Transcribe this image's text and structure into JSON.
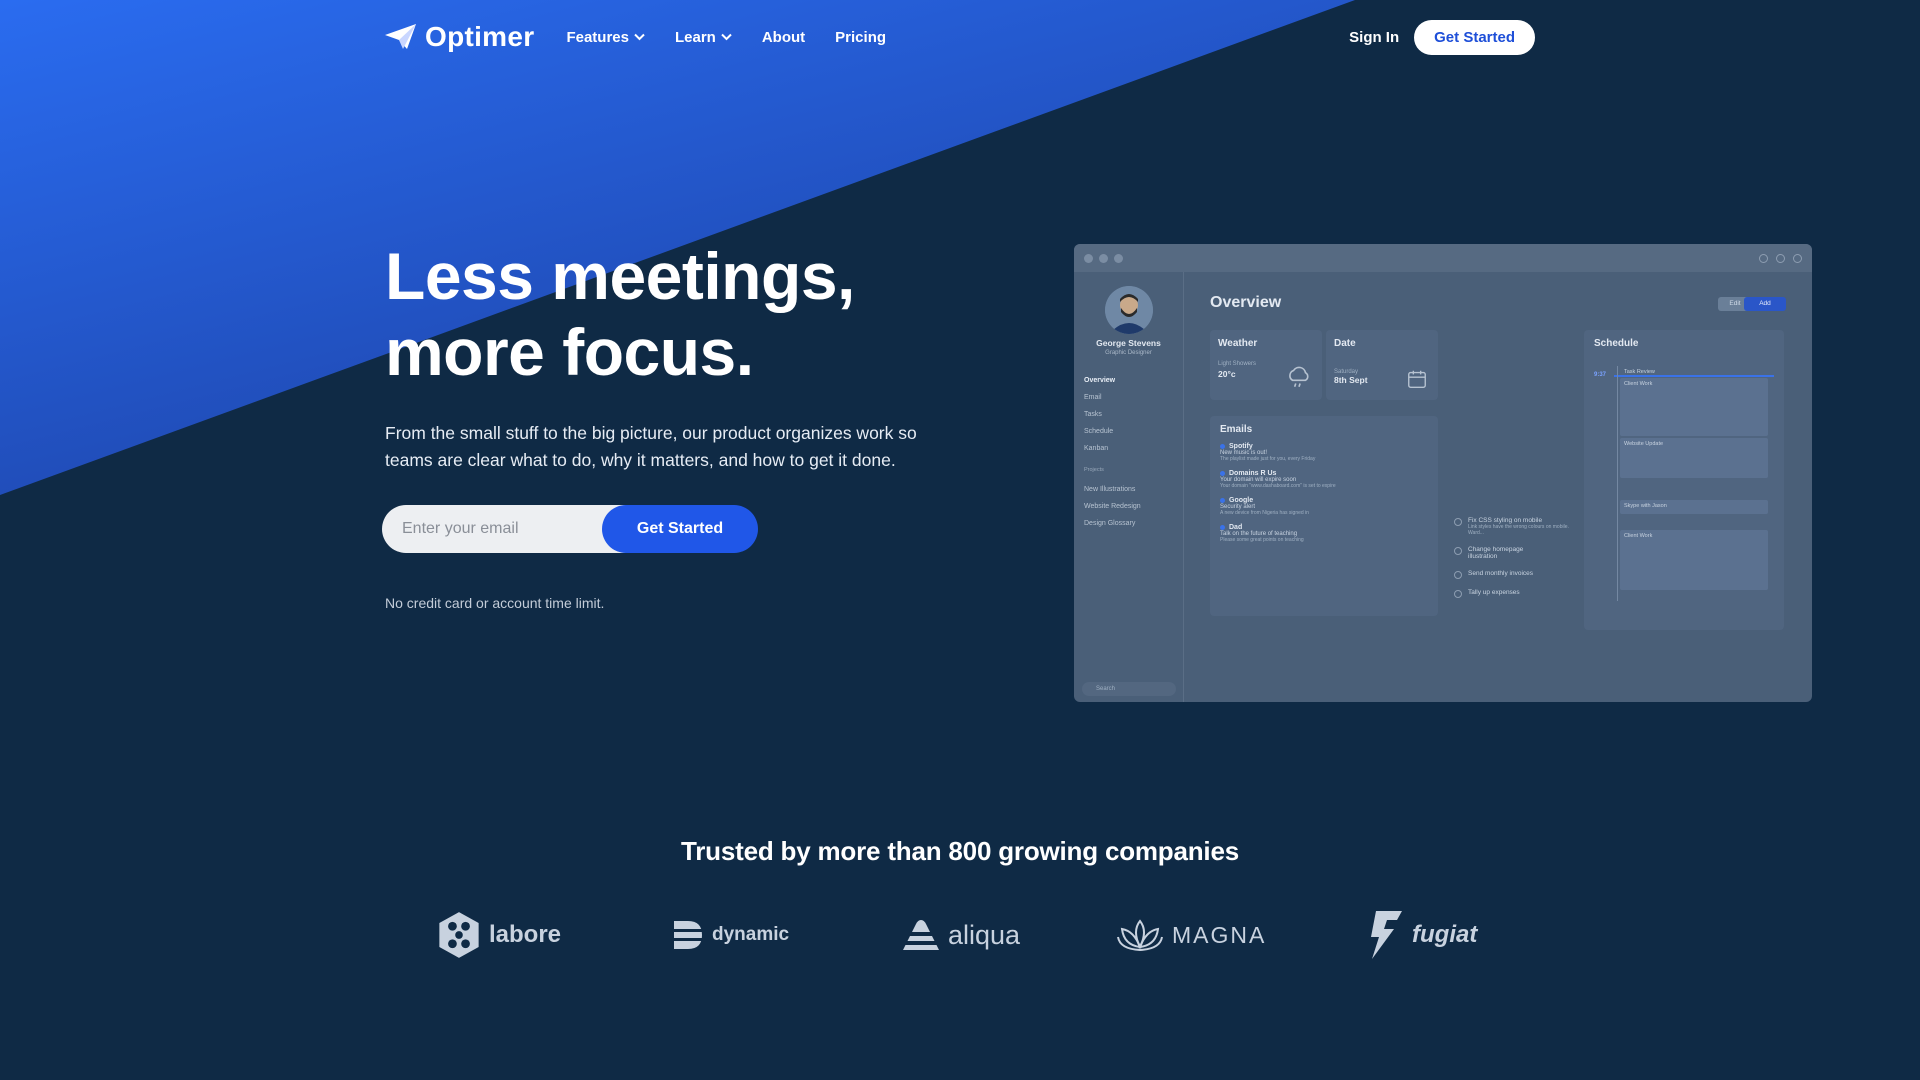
{
  "nav": {
    "brand": "Optimer",
    "menu": [
      {
        "label": "Features",
        "has_dropdown": true
      },
      {
        "label": "Learn",
        "has_dropdown": true
      },
      {
        "label": "About",
        "has_dropdown": false
      },
      {
        "label": "Pricing",
        "has_dropdown": false
      }
    ],
    "sign_in": "Sign In",
    "cta": "Get Started"
  },
  "hero": {
    "headline_line1": "Less meetings,",
    "headline_line2": "more focus.",
    "subtext": "From the small stuff to the big picture, our product organizes work so teams are clear what to do, why it matters, and how to get it done.",
    "email_placeholder": "Enter your email",
    "cta": "Get Started",
    "note": "No credit card or account time limit."
  },
  "mockup": {
    "user_name": "George Stevens",
    "user_role": "Graphic Designer",
    "sidebar": [
      "Overview",
      "Email",
      "Tasks",
      "Schedule",
      "Kanban"
    ],
    "projects_label": "Projects",
    "projects": [
      "New Illustrations",
      "Website Redesign",
      "Design Glossary"
    ],
    "search": "Search",
    "title": "Overview",
    "edit": "Edit",
    "add": "Add",
    "weather": {
      "title": "Weather",
      "desc": "Light Showers",
      "temp": "20°c"
    },
    "date": {
      "title": "Date",
      "day": "Saturday",
      "value": "8th Sept"
    },
    "emails_title": "Emails",
    "emails": [
      {
        "from": "Spotify",
        "subject": "New music is out!",
        "preview": "The playlist made just for you, every Friday"
      },
      {
        "from": "Domains R Us",
        "subject": "Your domain will expire soon",
        "preview": "Your domain \"www.dashaboard.com\" is set to expire"
      },
      {
        "from": "Google",
        "subject": "Security alert",
        "preview": "A new device from Nigeria has signed in"
      },
      {
        "from": "Dad",
        "subject": "Talk on the future of teaching",
        "preview": "Please some great points on teaching"
      }
    ],
    "tasks": [
      {
        "title": "Fix CSS styling on mobile",
        "desc": "Link styles have the wrong colours on mobile. Ward..."
      },
      {
        "title": "Change homepage illustration",
        "desc": ""
      },
      {
        "title": "Send monthly invoices",
        "desc": ""
      },
      {
        "title": "Tally up expenses",
        "desc": ""
      }
    ],
    "schedule_title": "Schedule",
    "schedule_time": "9:37",
    "schedule_items": [
      "Task Review",
      "Client Work",
      "Website Update",
      "Skype with Jason",
      "Client Work"
    ]
  },
  "trusted": {
    "heading": "Trusted by more than 800 growing companies",
    "logos": [
      {
        "name": "labore",
        "icon": "hexagon-molecule-icon"
      },
      {
        "name": "dynamic",
        "icon": "stacked-d-icon"
      },
      {
        "name": "aliqua",
        "icon": "triangle-stripes-icon"
      },
      {
        "name": "MAGNA",
        "icon": "lotus-icon"
      },
      {
        "name": "fugiat",
        "icon": "lightning-f-icon"
      }
    ]
  },
  "colors": {
    "background": "#0f2a45",
    "accent": "#2057e8",
    "hero_gradient_start": "#2a6cf0",
    "hero_gradient_end": "#1c3fa0"
  }
}
